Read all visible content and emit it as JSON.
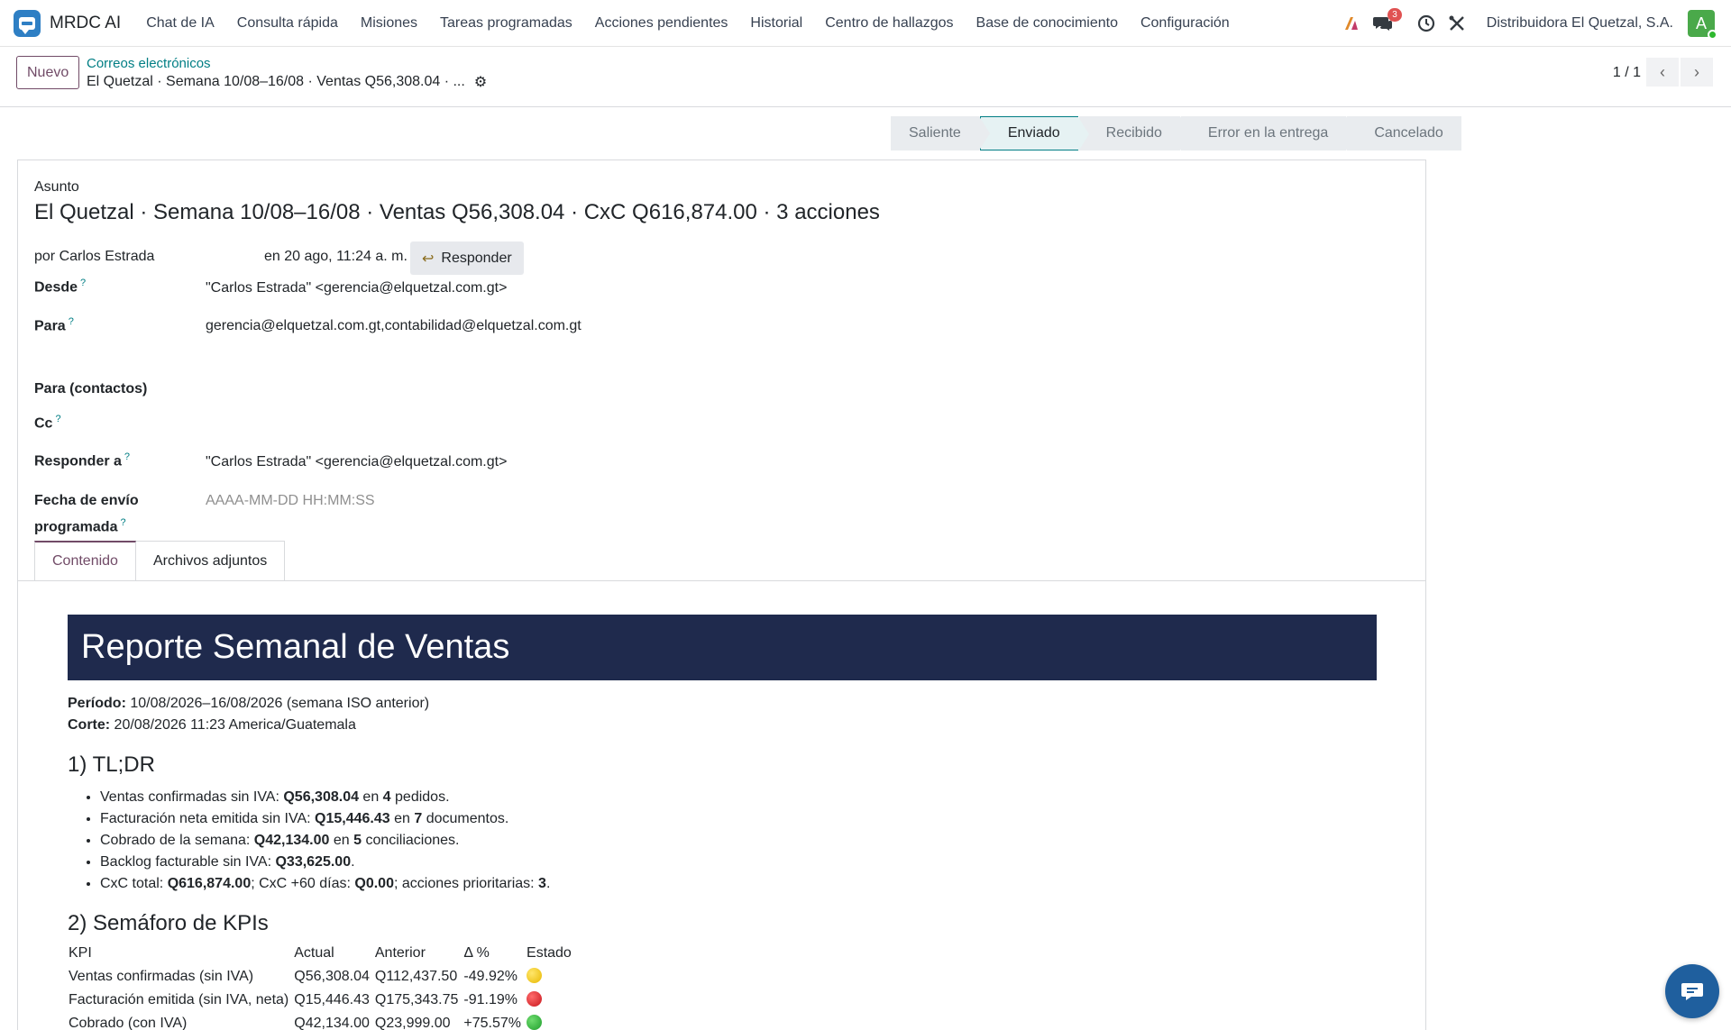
{
  "topnav": {
    "app_name": "MRDC AI",
    "menu": [
      "Chat de IA",
      "Consulta rápida",
      "Misiones",
      "Tareas programadas",
      "Acciones pendientes",
      "Historial",
      "Centro de hallazgos",
      "Base de conocimiento",
      "Configuración"
    ],
    "messages_badge": "3",
    "company": "Distribuidora El Quetzal, S.A.",
    "avatar_letter": "A"
  },
  "control": {
    "new_label": "Nuevo",
    "breadcrumb": "Correos electrónicos",
    "record_name": "El Quetzal · Semana 10/08–16/08 · Ventas Q56,308.04 · ...",
    "pager": "1 / 1"
  },
  "status": {
    "steps": [
      "Saliente",
      "Enviado",
      "Recibido",
      "Error en la entrega",
      "Cancelado"
    ],
    "active": "Enviado"
  },
  "form": {
    "subject_label": "Asunto",
    "subject": "El Quetzal · Semana 10/08–16/08 · Ventas Q56,308.04 · CxC Q616,874.00 · 3 acciones",
    "by": "por Carlos Estrada",
    "date": "en 20 ago, 11:24 a. m.",
    "reply_label": "Responder",
    "from_label": "Desde",
    "from": "\"Carlos Estrada\" <gerencia@elquetzal.com.gt>",
    "to_label": "Para",
    "to": "gerencia@elquetzal.com.gt,contabilidad@elquetzal.com.gt",
    "to_contacts_label": "Para (contactos)",
    "cc_label": "Cc",
    "reply_to_label": "Responder a",
    "reply_to": "\"Carlos Estrada\" <gerencia@elquetzal.com.gt>",
    "scheduled_label_1": "Fecha de envío",
    "scheduled_label_2": "programada",
    "scheduled_placeholder": "AAAA-MM-DD HH:MM:SS",
    "help_mark": "?"
  },
  "tabs": [
    "Contenido",
    "Archivos adjuntos"
  ],
  "email": {
    "banner": "Reporte Semanal de Ventas",
    "period_label": "Período:",
    "period": " 10/08/2026–16/08/2026 (semana ISO anterior)",
    "cut_label": "Corte:",
    "cut": " 20/08/2026 11:23 America/Guatemala",
    "h_tldr": "1) TL;DR",
    "bullets": [
      {
        "pre": "Ventas confirmadas sin IVA: ",
        "b1": "Q56,308.04",
        "mid": " en ",
        "b2": "4",
        "post": " pedidos."
      },
      {
        "pre": "Facturación neta emitida sin IVA: ",
        "b1": "Q15,446.43",
        "mid": " en ",
        "b2": "7",
        "post": " documentos."
      },
      {
        "pre": "Cobrado de la semana: ",
        "b1": "Q42,134.00",
        "mid": " en ",
        "b2": "5",
        "post": " conciliaciones."
      },
      {
        "pre": "Backlog facturable sin IVA: ",
        "b1": "Q33,625.00",
        "mid": "",
        "b2": "",
        "post": "."
      },
      {
        "pre": "CxC total: ",
        "b1": "Q616,874.00",
        "mid": "; CxC +60 días: ",
        "b2": "Q0.00",
        "post": "; acciones prioritarias: ",
        "b3": "3",
        "post2": "."
      }
    ],
    "h_kpis": "2) Semáforo de KPIs",
    "kpi_headers": [
      "KPI",
      "Actual",
      "Anterior",
      "Δ %",
      "Estado"
    ],
    "kpi_rows": [
      {
        "kpi": "Ventas confirmadas (sin IVA)",
        "actual": "Q56,308.04",
        "anterior": "Q112,437.50",
        "delta": "-49.92%",
        "estado": "yellow"
      },
      {
        "kpi": "Facturación emitida (sin IVA, neta)",
        "actual": "Q15,446.43",
        "anterior": "Q175,343.75",
        "delta": "-91.19%",
        "estado": "red"
      },
      {
        "kpi": "Cobrado (con IVA)",
        "actual": "Q42,134.00",
        "anterior": "Q23,999.00",
        "delta": "+75.57%",
        "estado": "green"
      }
    ]
  }
}
